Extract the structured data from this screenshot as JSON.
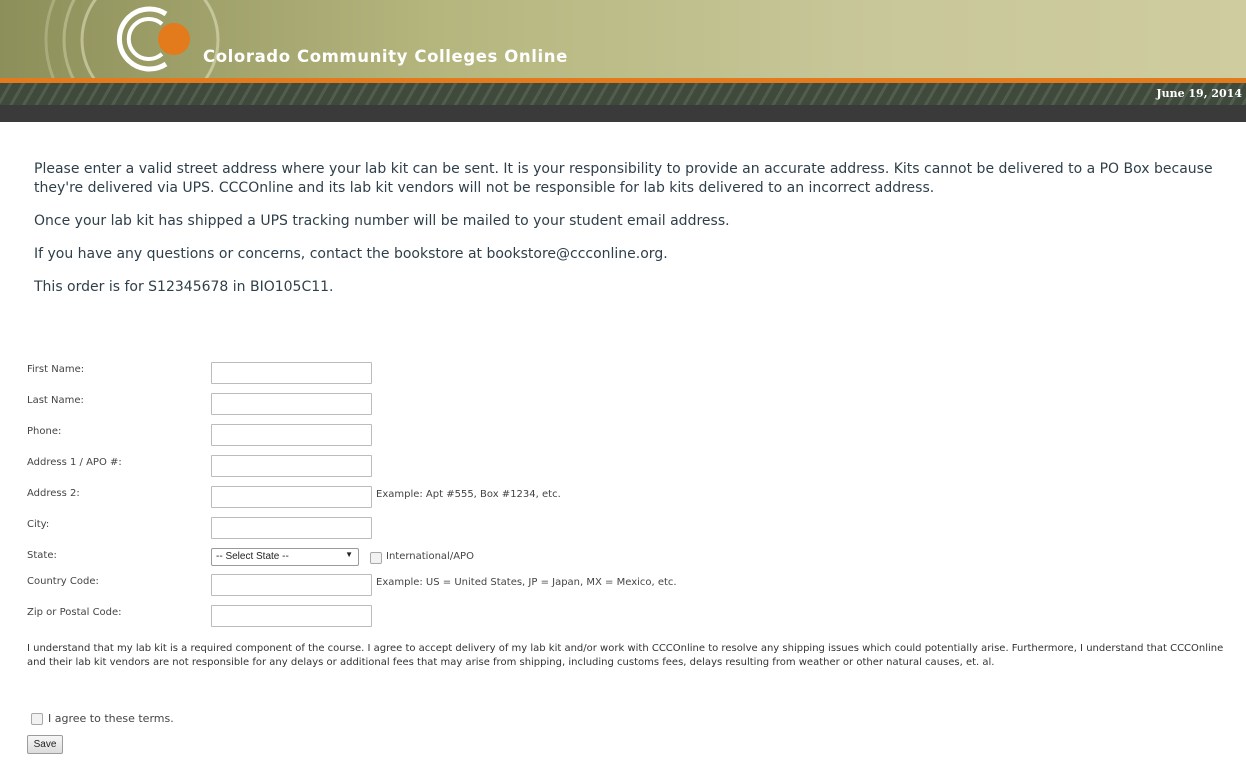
{
  "header": {
    "logo_text": "Colorado Community Colleges Online",
    "date": "June 19, 2014"
  },
  "intro": {
    "p1": "Please enter a valid street address where your lab kit can be sent. It is your responsibility to provide an accurate address. Kits cannot be delivered to a PO Box because they're delivered via UPS. CCCOnline and its lab kit vendors will not be responsible for lab kits delivered to an incorrect address.",
    "p2": "Once your lab kit has shipped a UPS tracking number will be mailed to your student email address.",
    "p3": "If you have any questions or concerns, contact the bookstore at bookstore@ccconline.org.",
    "p4": "This order is for S12345678 in BIO105C11."
  },
  "form": {
    "first_name": {
      "label": "First Name:",
      "value": ""
    },
    "last_name": {
      "label": "Last Name:",
      "value": ""
    },
    "phone": {
      "label": "Phone:",
      "value": ""
    },
    "address1": {
      "label": "Address 1 / APO #:",
      "value": ""
    },
    "address2": {
      "label": "Address 2:",
      "value": "",
      "hint": "Example: Apt #555, Box #1234, etc."
    },
    "city": {
      "label": "City:",
      "value": ""
    },
    "state": {
      "label": "State:",
      "selected": "-- Select State --",
      "international_label": "International/APO",
      "international_checked": false
    },
    "country_code": {
      "label": "Country Code:",
      "value": "",
      "hint": "Example: US = United States, JP = Japan, MX = Mexico, etc."
    },
    "zip": {
      "label": "Zip or Postal Code:",
      "value": ""
    },
    "terms_text": "I understand that my lab kit is a required component of the course. I agree to accept delivery of my lab kit and/or work with CCCOnline to resolve any shipping issues which could potentially arise. Furthermore, I understand that CCCOnline and their lab kit vendors are not responsible for any delays or additional fees that may arise from shipping, including customs fees, delays resulting from weather or other natural causes, et. al.",
    "agree_label": "I agree to these terms.",
    "agree_checked": false,
    "save_label": "Save"
  },
  "colors": {
    "banner": "#b5b67e",
    "accent_orange": "#e37a1c",
    "date_bar": "#3f4a3c",
    "intro_text": "#2f3f4a"
  }
}
